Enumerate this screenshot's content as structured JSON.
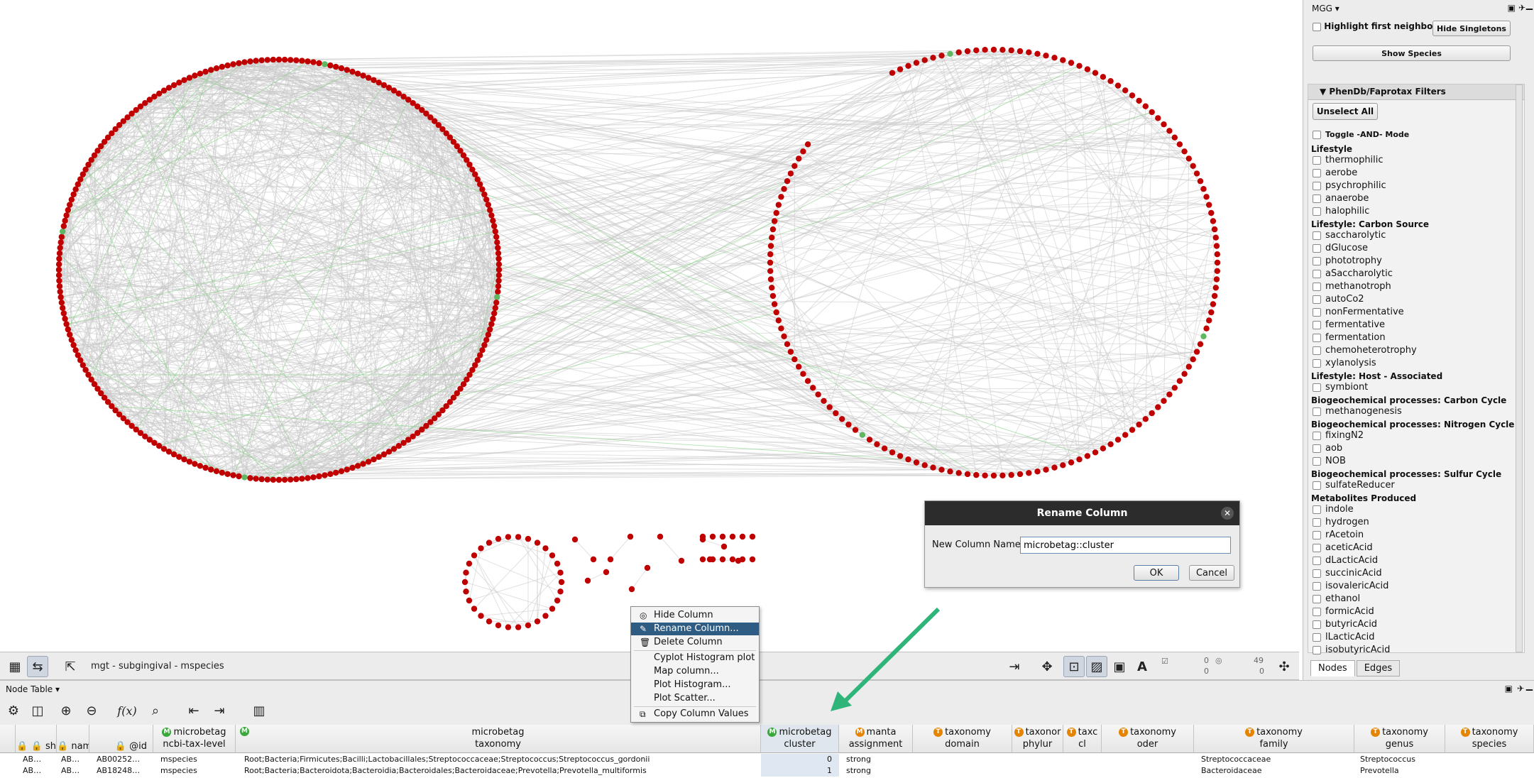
{
  "network": {
    "name": "mgt - subgingival - mspecies",
    "stats": {
      "sel_nodes": "0",
      "sel_edges": "0",
      "hidden_nodes": "49",
      "hidden_edges": "0"
    }
  },
  "right_panel": {
    "title": "MGG ▾",
    "highlight_label": "Highlight first neighbors",
    "hide_singletons": "Hide Singletons",
    "show_species": "Show Species",
    "filters_header": "PhenDb/Faprotax Filters",
    "unselect_all": "Unselect All",
    "toggle_and_mode": "Toggle -AND- Mode",
    "tabs": [
      "Nodes",
      "Edges"
    ]
  },
  "filters": [
    {
      "category": "Lifestyle",
      "items": [
        "thermophilic",
        "aerobe",
        "psychrophilic",
        "anaerobe",
        "halophilic"
      ]
    },
    {
      "category": "Lifestyle: Carbon Source",
      "items": [
        "saccharolytic",
        "dGlucose",
        "phototrophy",
        "aSaccharolytic",
        "methanotroph",
        "autoCo2",
        "nonFermentative",
        "fermentative",
        "fermentation",
        "chemoheterotrophy",
        "xylanolysis"
      ]
    },
    {
      "category": "Lifestyle: Host - Associated",
      "items": [
        "symbiont"
      ]
    },
    {
      "category": "Biogeochemical processes: Carbon Cycle",
      "items": [
        "methanogenesis"
      ]
    },
    {
      "category": "Biogeochemical processes: Nitrogen Cycle",
      "items": [
        "fixingN2",
        "aob",
        "NOB"
      ]
    },
    {
      "category": "Biogeochemical processes: Sulfur Cycle",
      "items": [
        "sulfateReducer"
      ]
    },
    {
      "category": "Metabolites Produced",
      "items": [
        "indole",
        "hydrogen",
        "rAcetoin",
        "aceticAcid",
        "dLacticAcid",
        "succinicAcid",
        "isovalericAcid",
        "ethanol",
        "formicAcid",
        "butyricAcid",
        "lLacticAcid",
        "isobutyricAcid"
      ]
    }
  ],
  "table": {
    "title": "Node Table ▾",
    "columns": [
      {
        "label": "sh",
        "badge": ""
      },
      {
        "label": "nam",
        "badge": ""
      },
      {
        "label": "@id",
        "badge": ""
      },
      {
        "line1": "microbetag",
        "line2": "ncbi-tax-level",
        "badge": "M"
      },
      {
        "line1": "microbetag",
        "line2": "taxonomy",
        "badge": "M"
      },
      {
        "line1": "microbetag",
        "line2": "cluster",
        "badge": "M"
      },
      {
        "line1": "manta",
        "line2": "assignment",
        "badge": "M"
      },
      {
        "line1": "taxonomy",
        "line2": "domain",
        "badge": "T"
      },
      {
        "line1": "taxonor",
        "line2": "phylur",
        "badge": "T"
      },
      {
        "line1": "taxc",
        "line2": "cl",
        "badge": "T"
      },
      {
        "line1": "taxonomy",
        "line2": "oder",
        "badge": "T"
      },
      {
        "line1": "taxonomy",
        "line2": "family",
        "badge": "T"
      },
      {
        "line1": "taxonomy",
        "line2": "genus",
        "badge": "T"
      },
      {
        "line1": "taxonomy",
        "line2": "species",
        "badge": "T"
      }
    ],
    "rows": [
      {
        "sh": "AB…",
        "nam": "AB…",
        "id": "AB00252…",
        "level": "mspecies",
        "taxonomy": "Root;Bacteria;Firmicutes;Bacilli;Lactobacillales;Streptococcaceae;Streptococcus;Streptococcus_gordonii",
        "cluster": "0",
        "manta": "strong",
        "family": "Streptococcaceae",
        "genus": "Streptococcus"
      },
      {
        "sh": "AB…",
        "nam": "AB…",
        "id": "AB18248…",
        "level": "mspecies",
        "taxonomy": "Root;Bacteria;Bacteroidota;Bacteroidia;Bacteroidales;Bacteroidaceae;Prevotella;Prevotella_multiformis",
        "cluster": "1",
        "manta": "strong",
        "family": "Bacteroidaceae",
        "genus": "Prevotella"
      }
    ]
  },
  "context_menu": {
    "items": [
      "Hide Column",
      "Rename Column...",
      "Delete Column",
      "Cyplot Histogram plot",
      "Map column...",
      "Plot Histogram...",
      "Plot Scatter...",
      "Copy Column Values"
    ],
    "highlighted": "Rename Column..."
  },
  "dialog": {
    "title": "Rename Column",
    "field_label": "New Column Name",
    "field_value": "microbetag::cluster",
    "ok": "OK",
    "cancel": "Cancel"
  },
  "colors": {
    "node": "#c00000",
    "highlight_node": "#5fb85f",
    "edge": "#c8c8c8",
    "arrow": "#2fb57a",
    "menu_highlight": "#2f5c82"
  }
}
